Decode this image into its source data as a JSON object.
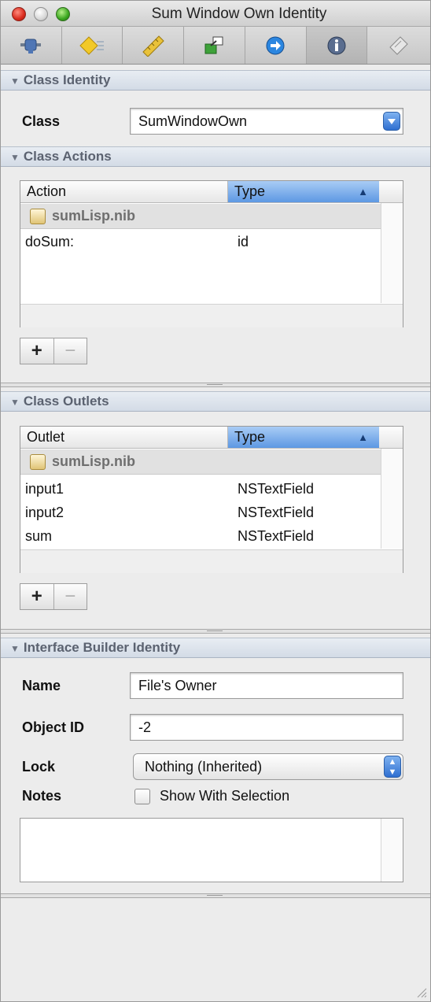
{
  "window": {
    "title": "Sum Window Own Identity"
  },
  "toolbar": {
    "icons": [
      "attributes-icon",
      "effects-icon",
      "size-icon",
      "connections-icon",
      "bindings-icon",
      "identity-icon",
      "applescript-icon"
    ],
    "active_index": 5
  },
  "class_identity": {
    "header": "Class Identity",
    "class_label": "Class",
    "class_value": "SumWindowOwn"
  },
  "class_actions": {
    "header": "Class Actions",
    "columns": [
      "Action",
      "Type"
    ],
    "sort_arrow": "▲",
    "group": "sumLisp.nib",
    "rows": [
      {
        "name": "doSum:",
        "type": "id"
      }
    ],
    "add_label": "+",
    "remove_label": "−"
  },
  "class_outlets": {
    "header": "Class Outlets",
    "columns": [
      "Outlet",
      "Type"
    ],
    "sort_arrow": "▲",
    "group": "sumLisp.nib",
    "rows": [
      {
        "name": "input1",
        "type": "NSTextField"
      },
      {
        "name": "input2",
        "type": "NSTextField"
      },
      {
        "name": "sum",
        "type": "NSTextField"
      }
    ],
    "add_label": "+",
    "remove_label": "−"
  },
  "ib_identity": {
    "header": "Interface Builder Identity",
    "name_label": "Name",
    "name_value": "File's Owner",
    "object_id_label": "Object ID",
    "object_id_value": "-2",
    "lock_label": "Lock",
    "lock_value": "Nothing (Inherited)",
    "notes_label": "Notes",
    "show_with_selection": "Show With Selection",
    "show_with_selection_checked": false
  }
}
